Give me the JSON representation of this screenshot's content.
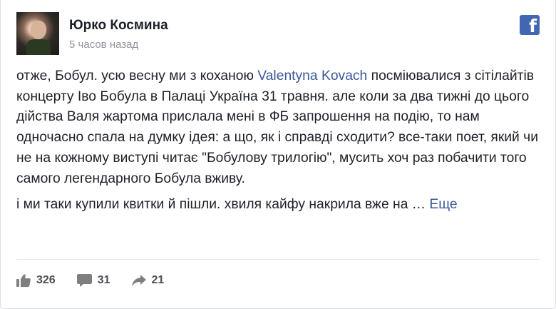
{
  "post": {
    "author": "Юрко Космина",
    "time": "5 часов назад",
    "paragraph1": {
      "before_mention": "отже, Бобул. усю весну ми з коханою ",
      "mention": "Valentyna Kovach",
      "after_mention": " посміювалися з сітілайтів концерту Іво Бобула в Палаці Україна 31 травня. але коли за два тижні до цього дійства Валя жартома прислала мені в ФБ запрошення на подію, то нам одночасно спала на думку ідея: а що, як і справді сходити? все-таки поет, який чи не на кожному виступі читає \"Бобулову трилогію\", мусить хоч раз побачити того самого легендарного Бобула вживу."
    },
    "paragraph2": {
      "text": "і ми таки купили квитки й пішли. хвиля кайфу накрила вже на … ",
      "more": "Еще"
    }
  },
  "actions": {
    "likes": "326",
    "comments": "31",
    "shares": "21"
  },
  "icons": {
    "logo": "facebook-f-icon",
    "like": "thumbs-up-icon",
    "comment": "speech-bubble-icon",
    "share": "share-arrow-icon"
  },
  "colors": {
    "link": "#385898",
    "brand": "#4267b2",
    "secondary_text": "#90949c",
    "action_text": "#4b4f56"
  }
}
